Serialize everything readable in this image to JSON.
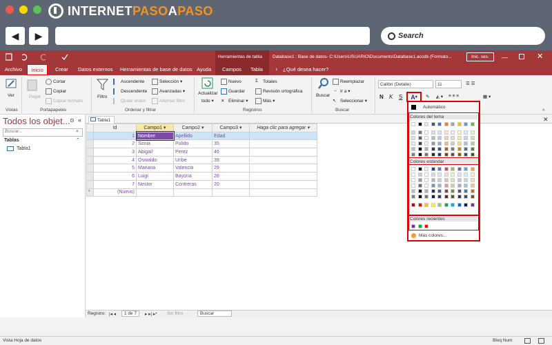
{
  "browser": {
    "logo_a": "INTERNET",
    "logo_b": "PASO",
    "logo_c": "A",
    "logo_d": "PASO",
    "search_label": "Search",
    "colors": {
      "close": "#ed594a",
      "min": "#fdd800",
      "max": "#5ac05a",
      "accent": "#f4931f"
    }
  },
  "titlebar": {
    "context_group": "Herramientas de tabla",
    "file_title": "Database1 : Base de datos- C:\\Users\\USUARIO\\Documents\\Database1.accdb (Formato...",
    "signin": "Inic. ses."
  },
  "tabs": [
    "Archivo",
    "Inicio",
    "Crear",
    "Datos externos",
    "Herramientas de base de datos",
    "Ayuda",
    "Campos",
    "Tabla"
  ],
  "tell_me": "¿Qué desea hacer?",
  "ribbon": {
    "vistas": {
      "ver": "Ver",
      "label": "Vistas"
    },
    "portapapeles": {
      "pegar": "Pegar",
      "cortar": "Cortar",
      "copiar": "Copiar",
      "copiar_formato": "Copiar formato",
      "label": "Portapapeles"
    },
    "ordenar": {
      "filtro": "Filtro",
      "ascendente": "Ascendente",
      "descendente": "Descendente",
      "quitar_orden": "Quitar orden",
      "seleccion": "Selección",
      "avanzadas": "Avanzadas",
      "alternar_filtro": "Alternar filtro",
      "label": "Ordenar y filtrar"
    },
    "registros": {
      "actualizar": "Actualizar",
      "todo": "todo",
      "nuevo": "Nuevo",
      "guardar": "Guardar",
      "eliminar": "Eliminar",
      "totales": "Totales",
      "revision": "Revisión ortográfica",
      "mas": "Más",
      "label": "Registros"
    },
    "buscar": {
      "buscar": "Buscar",
      "reemplazar": "Reemplazar",
      "ir_a": "Ir a",
      "seleccionar": "Seleccionar",
      "label": "Buscar"
    },
    "formato": {
      "font": "Calibri (Detalle)",
      "size": "11",
      "n": "N",
      "k": "K",
      "s": "S",
      "a": "A"
    }
  },
  "navpane": {
    "title": "Todos los objet...",
    "search_placeholder": "Buscar...",
    "group": "Tablas",
    "item": "Tabla1"
  },
  "doc_tab": "Tabla1",
  "datasheet": {
    "columns": [
      "Id",
      "Campo1",
      "Campo2",
      "Campo3",
      "Haga clic para agregar"
    ],
    "rows": [
      [
        "1",
        "Nombre",
        "Apellido",
        "Edad"
      ],
      [
        "2",
        "Sonia",
        "Pulido",
        "35"
      ],
      [
        "3",
        "Abigail",
        "Perez",
        "46"
      ],
      [
        "4",
        "Oswaldo",
        "Uribe",
        "39"
      ],
      [
        "5",
        "Mariana",
        "Valencia",
        "29"
      ],
      [
        "6",
        "Luigi",
        "Bayona",
        "28"
      ],
      [
        "7",
        "Nestor",
        "Contreras",
        "20"
      ]
    ],
    "new_row": "(Nuevo)"
  },
  "record_nav": {
    "label": "Registro:",
    "position": "1 de 7",
    "filter": "Sin filtro",
    "search": "Buscar"
  },
  "status": {
    "left": "Vista Hoja de datos",
    "right": "Bloq Num"
  },
  "color_picker": {
    "automatic": "Automático",
    "theme_label": "Colores del tema",
    "standard_label": "Colores estándar",
    "recent_label": "Colores recientes",
    "more": "Más colores...",
    "theme_top": [
      "#ffffff",
      "#000000",
      "#e7e6e6",
      "#44546a",
      "#4472c4",
      "#ed7d31",
      "#a5a5a5",
      "#ffc000",
      "#5b9bd5",
      "#70ad47"
    ],
    "standard_top": [
      "#ffffff",
      "#000000",
      "#eeece1",
      "#1f497d",
      "#4f81bd",
      "#c0504d",
      "#9bbb59",
      "#8064a2",
      "#4bacc6",
      "#f79646"
    ],
    "standard_bottom": [
      "#c00000",
      "#ff0000",
      "#ffc000",
      "#ffff00",
      "#92d050",
      "#00b050",
      "#00b0f0",
      "#0070c0",
      "#002060",
      "#7030a0"
    ],
    "recent": [
      "#7030a0",
      "#00b050",
      "#ff0000"
    ]
  }
}
